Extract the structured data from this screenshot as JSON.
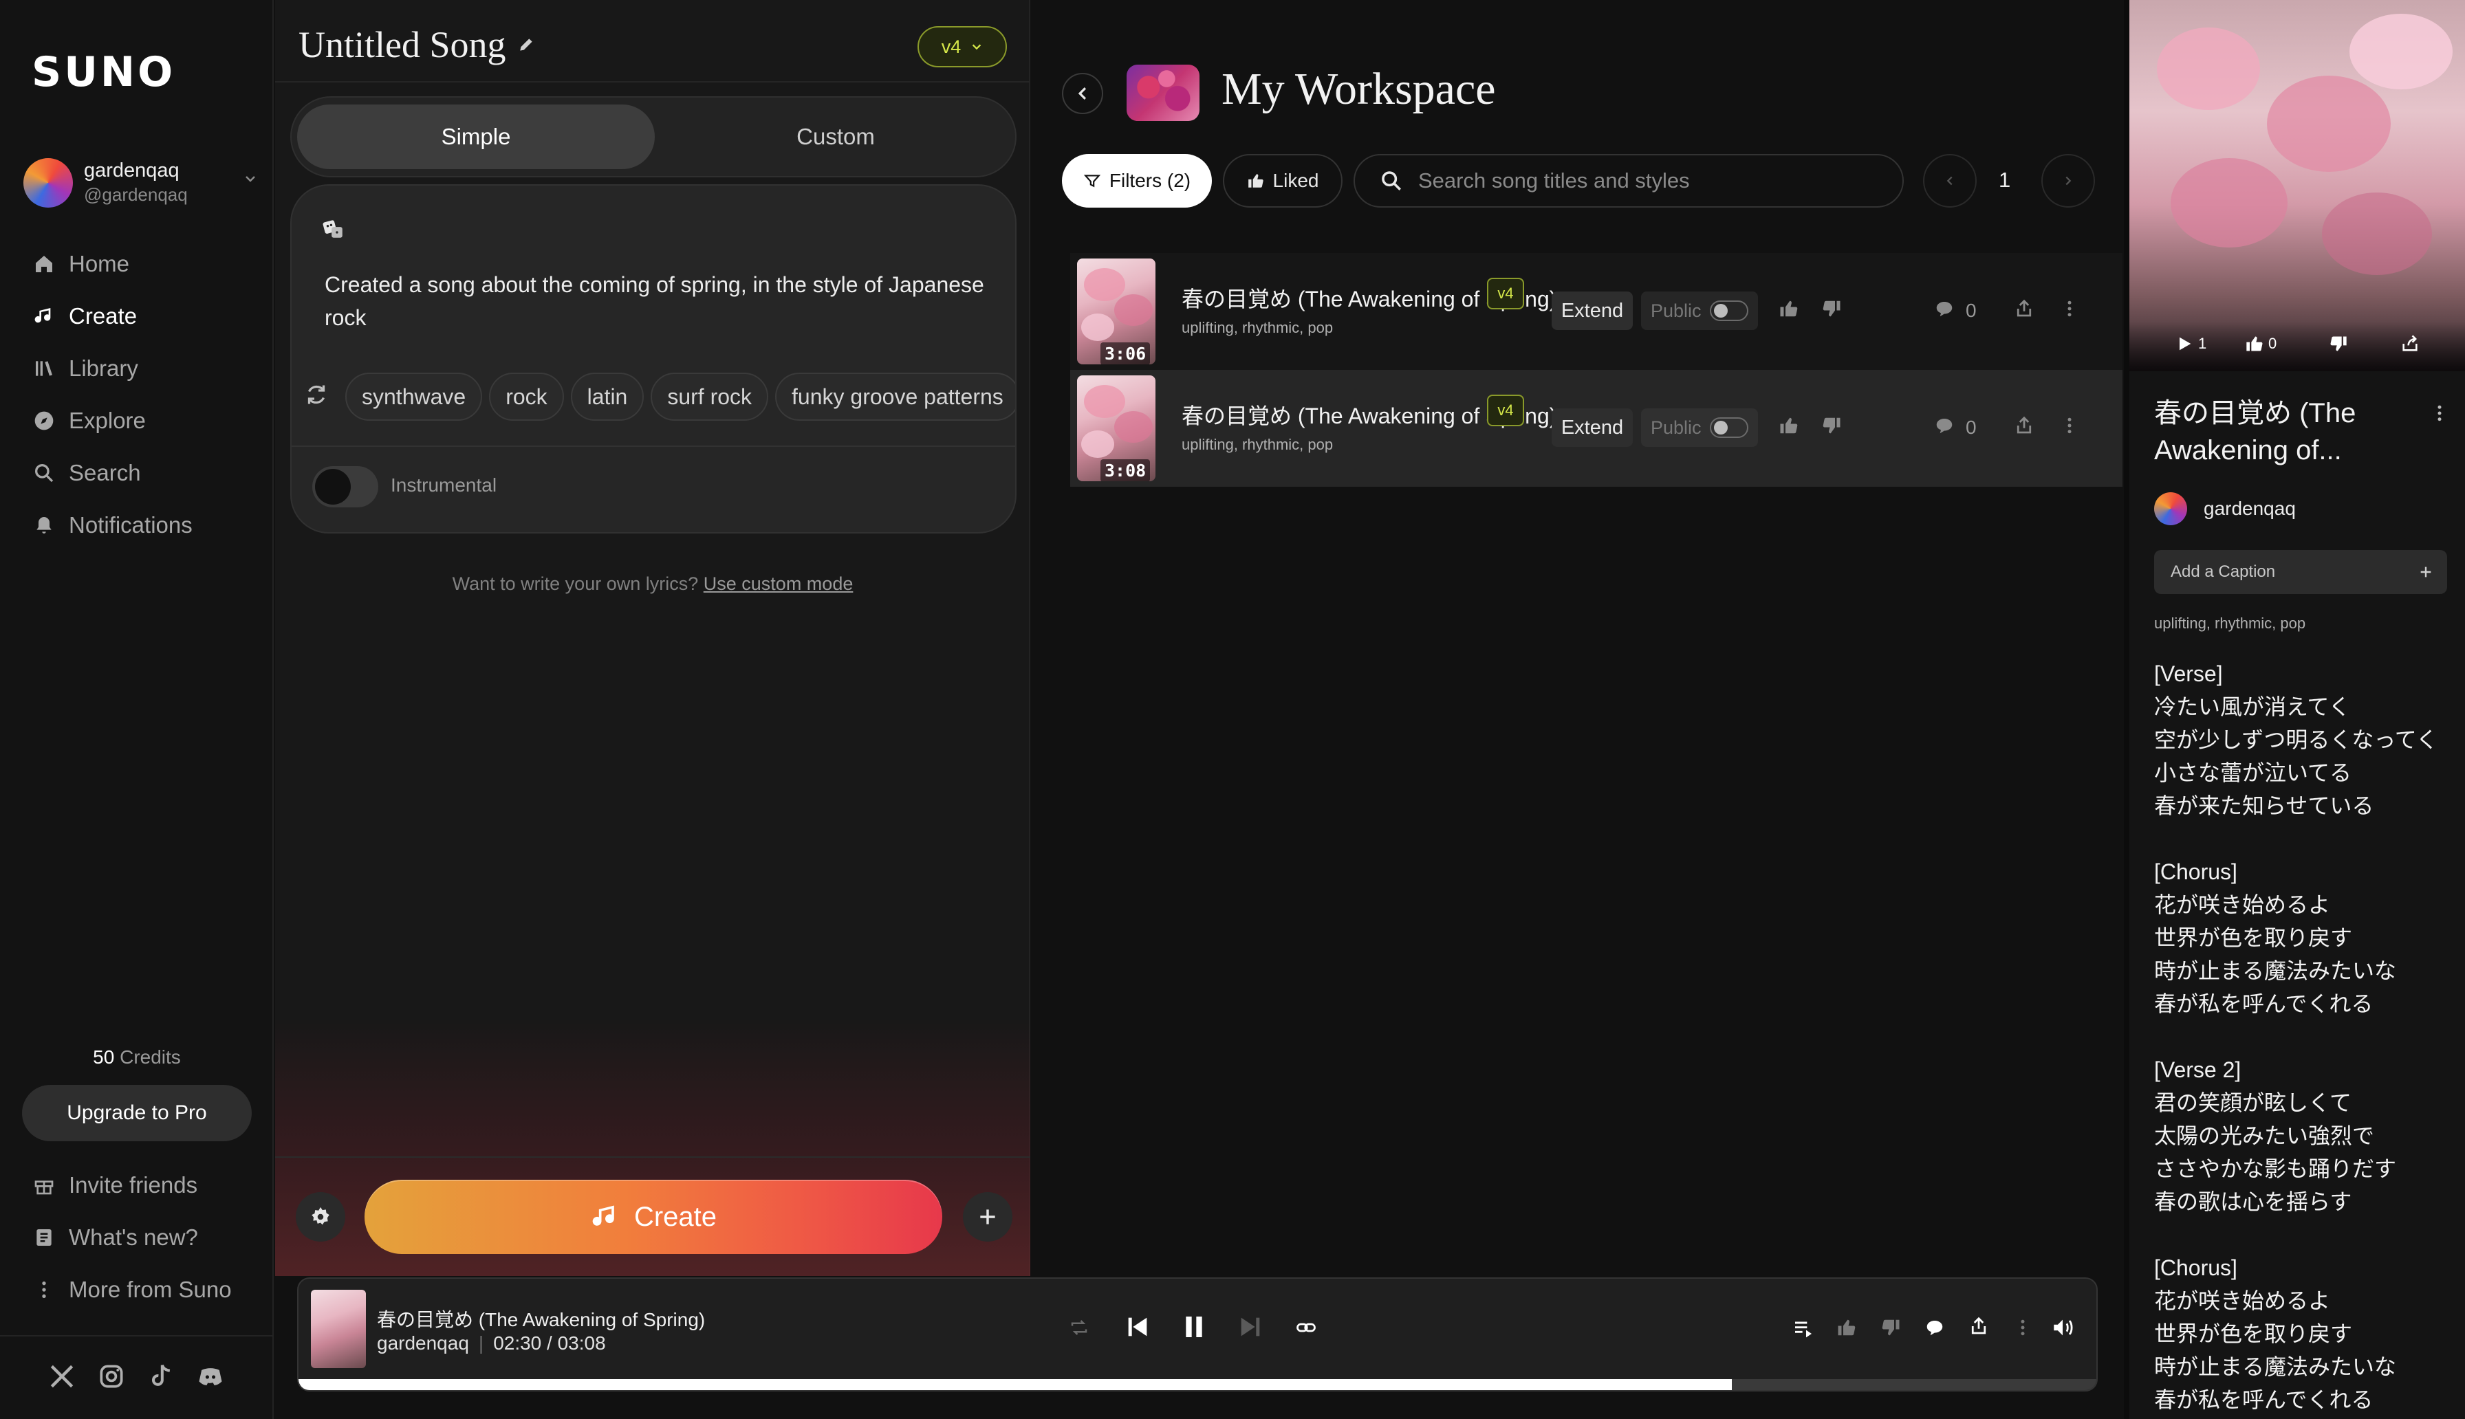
{
  "sidebar": {
    "logo": "SUNO",
    "user": {
      "name": "gardenqaq",
      "handle": "@gardenqaq"
    },
    "nav": [
      {
        "label": "Home",
        "icon": "home-icon"
      },
      {
        "label": "Create",
        "icon": "music-note-icon",
        "active": true
      },
      {
        "label": "Library",
        "icon": "library-icon"
      },
      {
        "label": "Explore",
        "icon": "compass-icon"
      },
      {
        "label": "Search",
        "icon": "search-icon"
      },
      {
        "label": "Notifications",
        "icon": "bell-icon"
      }
    ],
    "credits_number": "50",
    "credits_label": "Credits",
    "upgrade_label": "Upgrade to Pro",
    "footer_links": [
      {
        "label": "Invite friends",
        "icon": "gift-icon"
      },
      {
        "label": "What's new?",
        "icon": "news-icon"
      },
      {
        "label": "More from Suno",
        "icon": "more-vertical-icon"
      }
    ],
    "social": [
      "x-icon",
      "instagram-icon",
      "tiktok-icon",
      "discord-icon"
    ]
  },
  "create": {
    "song_title": "Untitled Song",
    "version": "v4",
    "modes": {
      "simple": "Simple",
      "custom": "Custom"
    },
    "active_mode": "Simple",
    "prompt": "Created a song about the coming of spring, in the style of Japanese rock",
    "tags": [
      "synthwave",
      "rock",
      "latin",
      "surf rock",
      "funky groove patterns"
    ],
    "instrumental_label": "Instrumental",
    "instrumental_on": false,
    "hint_text": "Want to write your own lyrics?",
    "hint_link": "Use custom mode",
    "create_label": "Create"
  },
  "workspace": {
    "title": "My Workspace",
    "filters_label": "Filters (2)",
    "liked_label": "Liked",
    "search_placeholder": "Search song titles and styles",
    "page": "1",
    "songs": [
      {
        "title": "春の目覚め (The Awakening of Spring)",
        "version": "v4",
        "tags": "uplifting, rhythmic, pop",
        "duration": "3:06",
        "extend": "Extend",
        "visibility": "Public",
        "comments": "0"
      },
      {
        "title": "春の目覚め (The Awakening of Spring)",
        "version": "v4",
        "tags": "uplifting, rhythmic, pop",
        "duration": "3:08",
        "extend": "Extend",
        "visibility": "Public",
        "comments": "0"
      }
    ]
  },
  "detail": {
    "plays": "1",
    "likes": "0",
    "title": "春の目覚め (The Awakening of...",
    "user": "gardenqaq",
    "caption_placeholder": "Add a Caption",
    "tags": "uplifting, rhythmic, pop",
    "lyrics": "[Verse]\n冷たい風が消えてく\n空が少しずつ明るくなってく\n小さな蕾が泣いてる\n春が来た知らせている\n\n[Chorus]\n花が咲き始めるよ\n世界が色を取り戻す\n時が止まる魔法みたいな\n春が私を呼んでくれる\n\n[Verse 2]\n君の笑顔が眩しくて\n太陽の光みたい強烈で\nささやかな影も踊りだす\n春の歌は心を揺らす\n\n[Chorus]\n花が咲き始めるよ\n世界が色を取り戻す\n時が止まる魔法みたいな\n春が私を呼んでくれる"
  },
  "player": {
    "title": "春の目覚め (The Awakening of Spring)",
    "artist": "gardenqaq",
    "time": "02:30 / 03:08",
    "progress": 0.796
  },
  "colors": {
    "accent_lime": "#d7e94a",
    "create_orange": "#f17e3c",
    "create_red": "#e7384b",
    "background": "#111111"
  }
}
